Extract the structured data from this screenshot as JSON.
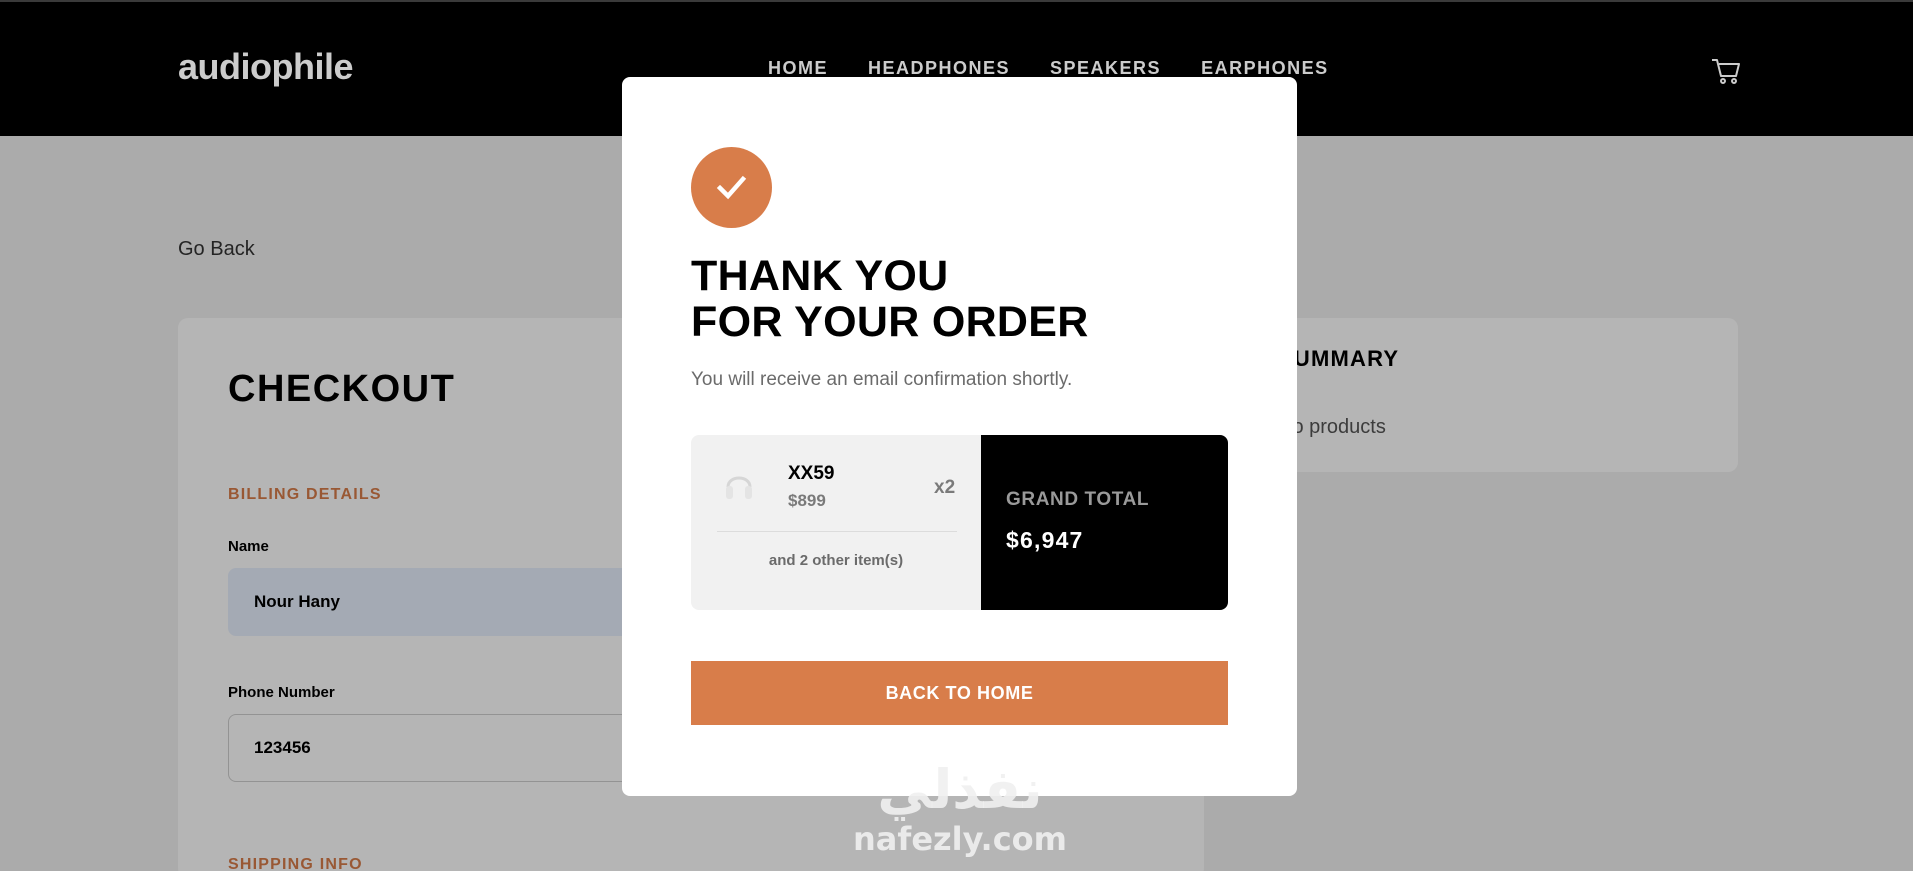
{
  "header": {
    "logo": "audiophile",
    "nav": [
      "HOME",
      "HEADPHONES",
      "SPEAKERS",
      "EARPHONES"
    ]
  },
  "page": {
    "go_back": "Go Back",
    "checkout": {
      "title": "CHECKOUT",
      "billing_label": "BILLING DETAILS",
      "name_label": "Name",
      "name_value": "Nour Hany",
      "phone_label": "Phone Number",
      "phone_value": "123456",
      "shipping_label": "SHIPPING INFO"
    },
    "summary": {
      "title": "SUMMARY",
      "empty_text": "No products"
    }
  },
  "modal": {
    "title_line1": "THANK YOU",
    "title_line2": "FOR YOUR ORDER",
    "subtitle": "You will receive an email confirmation shortly.",
    "item": {
      "name": "XX59",
      "price": "$899",
      "qty": "x2"
    },
    "more_items": "and 2 other item(s)",
    "grand_total_label": "GRAND TOTAL",
    "grand_total_value": "$6,947",
    "back_button": "BACK TO HOME"
  },
  "watermark": {
    "arabic": "نفذلي",
    "latin": "nafezly.com"
  },
  "colors": {
    "accent": "#d87d4a",
    "header_bg": "#000000",
    "page_bg": "#f1f1f1"
  }
}
